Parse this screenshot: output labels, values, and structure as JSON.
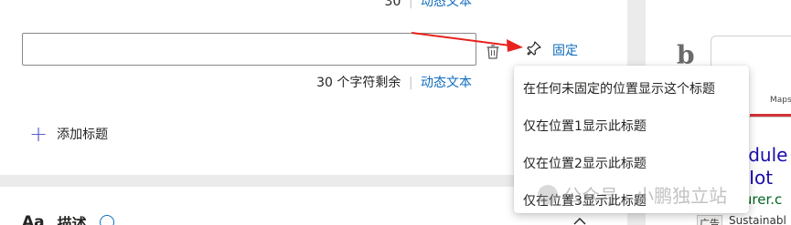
{
  "counter": {
    "top_count": "30",
    "count": "30 个字符剩余",
    "separator": "|",
    "dynamic_text_link": "动态文本"
  },
  "title_input": {
    "value": "",
    "placeholder": ""
  },
  "pin": {
    "label": "固定"
  },
  "add_title": {
    "label": "添加标题"
  },
  "menu": {
    "items": [
      "在任何未固定的位置显示这个标题",
      "仅在位置1显示此标题",
      "仅在位置2显示此标题",
      "仅在位置3显示此标题"
    ]
  },
  "description": {
    "label": "描述",
    "aa": "Aa"
  },
  "preview": {
    "maps_tab": "Maps",
    "ad_title_line1": "odule",
    "ad_title_line2": "| Iot",
    "ad_url": "turer.c",
    "ad_badge": "广告",
    "ad_text": "Sustainabl"
  },
  "watermark": {
    "text": "公众号 · 小鹏独立站"
  },
  "colors": {
    "link": "#0f6cbd",
    "arrow": "#e8221d",
    "plus": "#5b5fc7"
  }
}
